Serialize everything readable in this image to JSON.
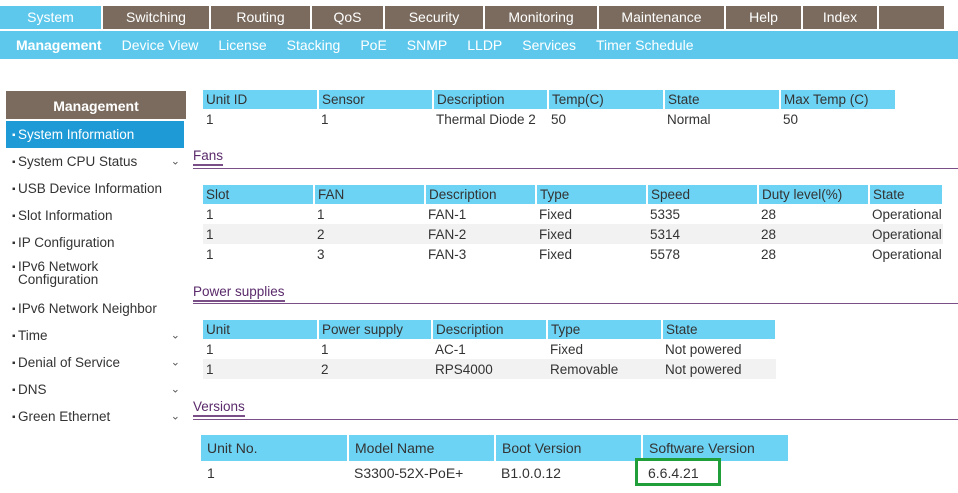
{
  "topnav": [
    {
      "label": "System",
      "active": true
    },
    {
      "label": "Switching"
    },
    {
      "label": "Routing"
    },
    {
      "label": "QoS"
    },
    {
      "label": "Security"
    },
    {
      "label": "Monitoring"
    },
    {
      "label": "Maintenance"
    },
    {
      "label": "Help"
    },
    {
      "label": "Index"
    }
  ],
  "subnav": [
    "Management",
    "Device View",
    "License",
    "Stacking",
    "PoE",
    "SNMP",
    "LLDP",
    "Services",
    "Timer Schedule"
  ],
  "sidebar": {
    "title": "Management",
    "items": [
      {
        "label": "System Information",
        "active": true
      },
      {
        "label": "System CPU Status",
        "chevron": true
      },
      {
        "label": "USB Device Information"
      },
      {
        "label": "Slot Information"
      },
      {
        "label": "IP Configuration"
      },
      {
        "label": "IPv6 Network Configuration"
      },
      {
        "label": "IPv6 Network Neighbor"
      },
      {
        "label": "Time",
        "chevron": true
      },
      {
        "label": "Denial of Service",
        "chevron": true
      },
      {
        "label": "DNS",
        "chevron": true
      },
      {
        "label": "Green Ethernet",
        "chevron": true
      }
    ]
  },
  "temperature": {
    "headers": [
      "Unit ID",
      "Sensor",
      "Description",
      "Temp(C)",
      "State",
      "Max Temp (C)"
    ],
    "rows": [
      [
        "1",
        "1",
        "Thermal Diode 2",
        "50",
        "Normal",
        "50"
      ]
    ]
  },
  "fans": {
    "title": "Fans",
    "headers": [
      "Slot",
      "FAN",
      "Description",
      "Type",
      "Speed",
      "Duty level(%)",
      "State"
    ],
    "rows": [
      [
        "1",
        "1",
        "FAN-1",
        "Fixed",
        "5335",
        "28",
        "Operational"
      ],
      [
        "1",
        "2",
        "FAN-2",
        "Fixed",
        "5314",
        "28",
        "Operational"
      ],
      [
        "1",
        "3",
        "FAN-3",
        "Fixed",
        "5578",
        "28",
        "Operational"
      ]
    ]
  },
  "power": {
    "title": "Power supplies",
    "headers": [
      "Unit",
      "Power supply",
      "Description",
      "Type",
      "State"
    ],
    "rows": [
      [
        "1",
        "1",
        "AC-1",
        "Fixed",
        "Not powered"
      ],
      [
        "1",
        "2",
        "RPS4000",
        "Removable",
        "Not powered"
      ]
    ]
  },
  "versions": {
    "title": "Versions",
    "headers": [
      "Unit No.",
      "Model Name",
      "Boot Version",
      "Software Version"
    ],
    "rows": [
      [
        "1",
        "S3300-52X-PoE+",
        "B1.0.0.12",
        "6.6.4.21"
      ]
    ]
  },
  "colors": {
    "accent": "#5dc8ec",
    "nav": "#7a6b5e",
    "highlight": "#1f9e3a"
  }
}
